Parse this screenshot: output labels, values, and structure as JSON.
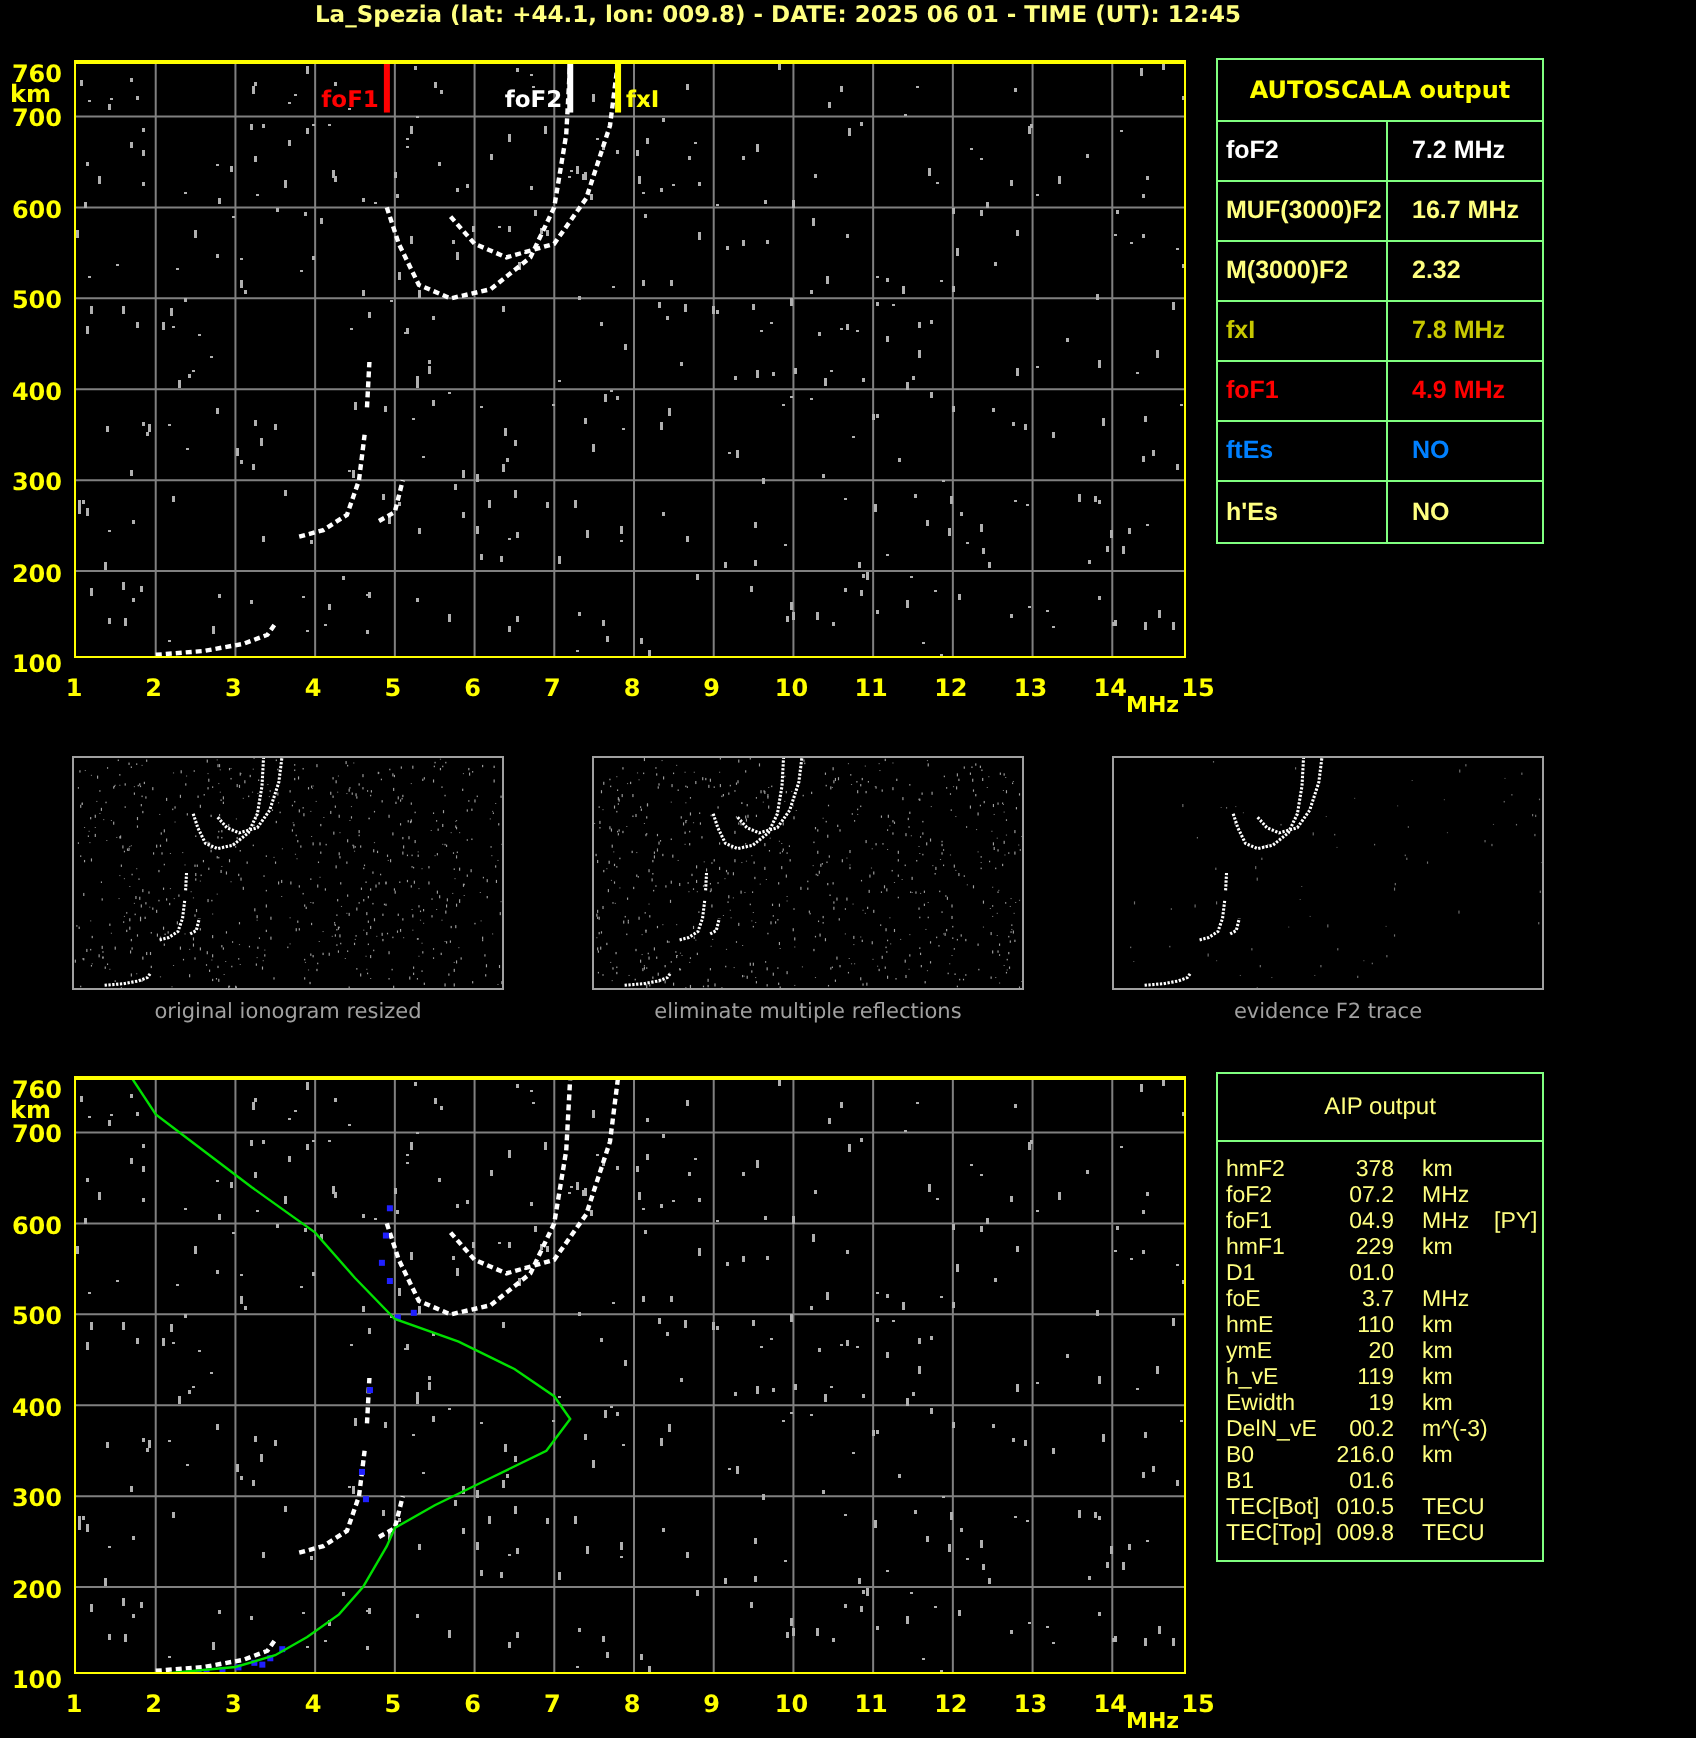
{
  "title": "La_Spezia (lat: +44.1, lon: 009.8) - DATE: 2025 06 01 - TIME (UT): 12:45",
  "top_ionogram": {
    "y_ticks": [
      "760",
      "700",
      "600",
      "500",
      "400",
      "300",
      "200",
      "100"
    ],
    "y_unit": "km",
    "x_ticks": [
      "1",
      "2",
      "3",
      "4",
      "5",
      "6",
      "7",
      "8",
      "9",
      "10",
      "11",
      "12",
      "13",
      "14",
      "15"
    ],
    "x_unit": "MHz",
    "markers": [
      {
        "label": "foF1",
        "color": "#ff0000"
      },
      {
        "label": "foF2",
        "color": "#ffffff"
      },
      {
        "label": "fxI",
        "color": "#ffff00"
      }
    ]
  },
  "autoscala": {
    "title": "AUTOSCALA output",
    "rows": [
      {
        "label": "foF2",
        "value": "7.2 MHz",
        "color": "#ffffff"
      },
      {
        "label": "MUF(3000)F2",
        "value": "16.7 MHz",
        "color": "#ffff80"
      },
      {
        "label": "M(3000)F2",
        "value": "2.32",
        "color": "#ffff80"
      },
      {
        "label": "fxI",
        "value": "7.8 MHz",
        "color": "#c8c800"
      },
      {
        "label": "foF1",
        "value": "4.9 MHz",
        "color": "#ff0000"
      },
      {
        "label": "ftEs",
        "value": "NO",
        "color": "#0080ff"
      },
      {
        "label": "h'Es",
        "value": "NO",
        "color": "#ffff80"
      }
    ]
  },
  "thumbnails": [
    {
      "caption": "original ionogram resized"
    },
    {
      "caption": "eliminate multiple reflections"
    },
    {
      "caption": "evidence F2 trace"
    }
  ],
  "bottom_ionogram": {
    "y_ticks": [
      "760",
      "700",
      "600",
      "500",
      "400",
      "300",
      "200",
      "100"
    ],
    "y_unit": "km",
    "x_ticks": [
      "1",
      "2",
      "3",
      "4",
      "5",
      "6",
      "7",
      "8",
      "9",
      "10",
      "11",
      "12",
      "13",
      "14",
      "15"
    ],
    "x_unit": "MHz"
  },
  "aip": {
    "title": "AIP output",
    "rows": [
      {
        "name": "hmF2",
        "value": "378",
        "unit": "km"
      },
      {
        "name": "foF2",
        "value": "07.2",
        "unit": "MHz"
      },
      {
        "name": "foF1",
        "value": "04.9",
        "unit": "MHz",
        "note": "[PY]"
      },
      {
        "name": "hmF1",
        "value": "229",
        "unit": "km"
      },
      {
        "name": "D1",
        "value": "01.0"
      },
      {
        "name": "foE",
        "value": "3.7",
        "unit": "MHz"
      },
      {
        "name": "hmE",
        "value": "110",
        "unit": "km"
      },
      {
        "name": "ymE",
        "value": "20",
        "unit": "km"
      },
      {
        "name": "h_vE",
        "value": "119",
        "unit": "km"
      },
      {
        "name": "Ewidth",
        "value": "19",
        "unit": "km"
      },
      {
        "name": "DelN_vE",
        "value": "00.2",
        "unit": "m^(-3)"
      },
      {
        "name": "B0",
        "value": "216.0",
        "unit": "km"
      },
      {
        "name": "B1",
        "value": "01.6"
      },
      {
        "name": "TEC[Bot]",
        "value": "010.5",
        "unit": "TECU"
      },
      {
        "name": "TEC[Top]",
        "value": "009.8",
        "unit": "TECU"
      }
    ]
  }
}
